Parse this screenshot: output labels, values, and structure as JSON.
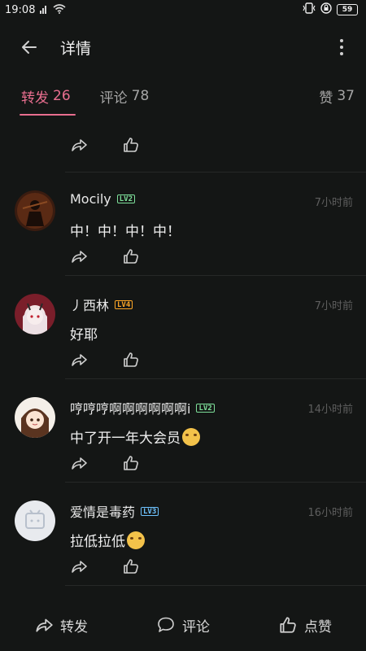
{
  "status_bar": {
    "time": "19:08",
    "battery": "59"
  },
  "header": {
    "title": "详情"
  },
  "tabs": [
    {
      "label": "转发",
      "count": "26"
    },
    {
      "label": "评论",
      "count": "78"
    },
    {
      "label": "赞",
      "count": "37"
    }
  ],
  "comments": [
    {
      "username": "Mocily",
      "level": "LV2",
      "time": "7小时前",
      "text": "中！中！中！中！"
    },
    {
      "username": "丿西林",
      "level": "LV4",
      "time": "7小时前",
      "text": "好耶"
    },
    {
      "username": "哼哼哼啊啊啊啊啊啊i",
      "level": "LV2",
      "time": "14小时前",
      "text": "中了开一年大会员"
    },
    {
      "username": "爱情是毒药",
      "level": "LV3",
      "time": "16小时前",
      "text": "拉低拉低"
    }
  ],
  "bottom_bar": {
    "repost": "转发",
    "comment": "评论",
    "like": "点赞"
  },
  "colors": {
    "accent": "#e86e8f",
    "background": "#141615"
  }
}
